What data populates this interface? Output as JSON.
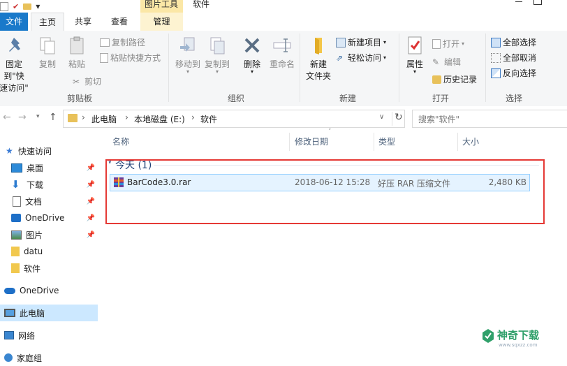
{
  "window": {
    "title": "软件",
    "context_tab": "图片工具"
  },
  "tabs": {
    "file": "文件",
    "home": "主页",
    "share": "共享",
    "view": "查看",
    "manage": "管理"
  },
  "ribbon": {
    "clipboard": {
      "pin_quick_line1": "固定到\"快",
      "pin_quick_line2": "速访问\"",
      "copy": "复制",
      "paste": "粘贴",
      "copy_path": "复制路径",
      "paste_shortcut": "粘贴快捷方式",
      "cut": "剪切",
      "label": "剪贴板"
    },
    "organize": {
      "move_to": "移动到",
      "copy_to": "复制到",
      "delete": "删除",
      "rename": "重命名",
      "label": "组织"
    },
    "new": {
      "new_folder_line1": "新建",
      "new_folder_line2": "文件夹",
      "new_item": "新建项目",
      "easy_access": "轻松访问",
      "label": "新建"
    },
    "open": {
      "properties": "属性",
      "open": "打开",
      "edit": "编辑",
      "history": "历史记录",
      "label": "打开"
    },
    "select": {
      "select_all": "全部选择",
      "select_none": "全部取消",
      "invert": "反向选择",
      "label": "选择"
    }
  },
  "address": {
    "crumbs": [
      "此电脑",
      "本地磁盘 (E:)",
      "软件"
    ],
    "search_placeholder": "搜索\"软件\""
  },
  "nav": {
    "quick_access": "快速访问",
    "items": [
      {
        "label": "桌面",
        "pinned": true
      },
      {
        "label": "下载",
        "pinned": true
      },
      {
        "label": "文档",
        "pinned": true
      },
      {
        "label": "OneDrive",
        "pinned": true
      },
      {
        "label": "图片",
        "pinned": true
      },
      {
        "label": "datu",
        "pinned": false
      },
      {
        "label": "软件",
        "pinned": false
      }
    ],
    "onedrive": "OneDrive",
    "this_pc": "此电脑",
    "network": "网络",
    "homegroup": "家庭组"
  },
  "list": {
    "columns": {
      "name": "名称",
      "date": "修改日期",
      "type": "类型",
      "size": "大小"
    },
    "group": "今天 (1)",
    "files": [
      {
        "name": "BarCode3.0.rar",
        "date": "2018-06-12 15:28",
        "type": "好压 RAR 压缩文件",
        "size": "2,480 KB"
      }
    ]
  },
  "watermark": {
    "text": "神奇下载",
    "url": "www.sqxzz.com"
  },
  "colors": {
    "accent": "#1979ca",
    "highlight_box": "#e53935",
    "context_tab": "#fbe7a6",
    "selection": "#cce8ff"
  }
}
